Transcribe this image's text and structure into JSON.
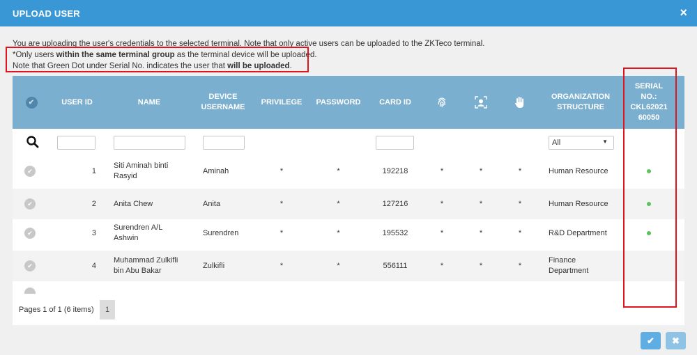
{
  "dialog": {
    "title": "UPLOAD USER",
    "close_icon": "×"
  },
  "notes": {
    "line1": "You are uploading the user's credentials to the selected terminal. Note that only active users can be uploaded to the ZKTeco terminal.",
    "line2_a": "*Only users ",
    "line2_b": "within the same terminal group",
    "line2_c": " as the terminal device will be uploaded.",
    "line3_a": "Note that Green Dot under Serial No. indicates the user that ",
    "line3_b": "will be uploaded",
    "line3_c": "."
  },
  "table": {
    "headers": {
      "user_id": "USER ID",
      "name": "NAME",
      "device_username_1": "DEVICE",
      "device_username_2": "USERNAME",
      "privilege": "PRIVILEGE",
      "password": "PASSWORD",
      "card_id": "CARD ID",
      "org_1": "ORGANIZATION",
      "org_2": "STRUCTURE",
      "serial_1": "SERIAL",
      "serial_2": "NO.:",
      "serial_3": "CKL62021",
      "serial_4": "60050"
    },
    "icons": [
      "fingerprint-icon",
      "face-icon",
      "palm-icon",
      "search-icon",
      "check-icon"
    ],
    "org_filter_value": "All",
    "rows": [
      {
        "user_id": "1",
        "name_1": "Siti Aminah binti",
        "name_2": "Rasyid",
        "device_username": "Aminah",
        "privilege": "*",
        "password": "*",
        "card_id": "192218",
        "fp": "*",
        "face": "*",
        "palm": "*",
        "org_1": "Human Resource",
        "org_2": "",
        "upload": true
      },
      {
        "user_id": "2",
        "name_1": "Anita Chew",
        "name_2": "",
        "device_username": "Anita",
        "privilege": "*",
        "password": "*",
        "card_id": "127216",
        "fp": "*",
        "face": "*",
        "palm": "*",
        "org_1": "Human Resource",
        "org_2": "",
        "upload": true
      },
      {
        "user_id": "3",
        "name_1": "Surendren A/L",
        "name_2": "Ashwin",
        "device_username": "Surendren",
        "privilege": "*",
        "password": "*",
        "card_id": "195532",
        "fp": "*",
        "face": "*",
        "palm": "*",
        "org_1": "R&D Department",
        "org_2": "",
        "upload": true
      },
      {
        "user_id": "4",
        "name_1": "Muhammad Zulkifli",
        "name_2": "bin Abu Bakar",
        "device_username": "Zulkifli",
        "privilege": "*",
        "password": "*",
        "card_id": "556111",
        "fp": "*",
        "face": "*",
        "palm": "*",
        "org_1": "Finance",
        "org_2": "Department",
        "upload": false
      }
    ]
  },
  "pagination": {
    "info": "Pages 1 of 1 (6 items)",
    "current_page": "1"
  },
  "actions": {
    "confirm_icon": "✔",
    "cancel_icon": "✖"
  },
  "colors": {
    "titlebar": "#3a97d6",
    "table_header": "#7aafcf",
    "upload_dot": "#5cc35c",
    "highlight": "#e0141e"
  }
}
